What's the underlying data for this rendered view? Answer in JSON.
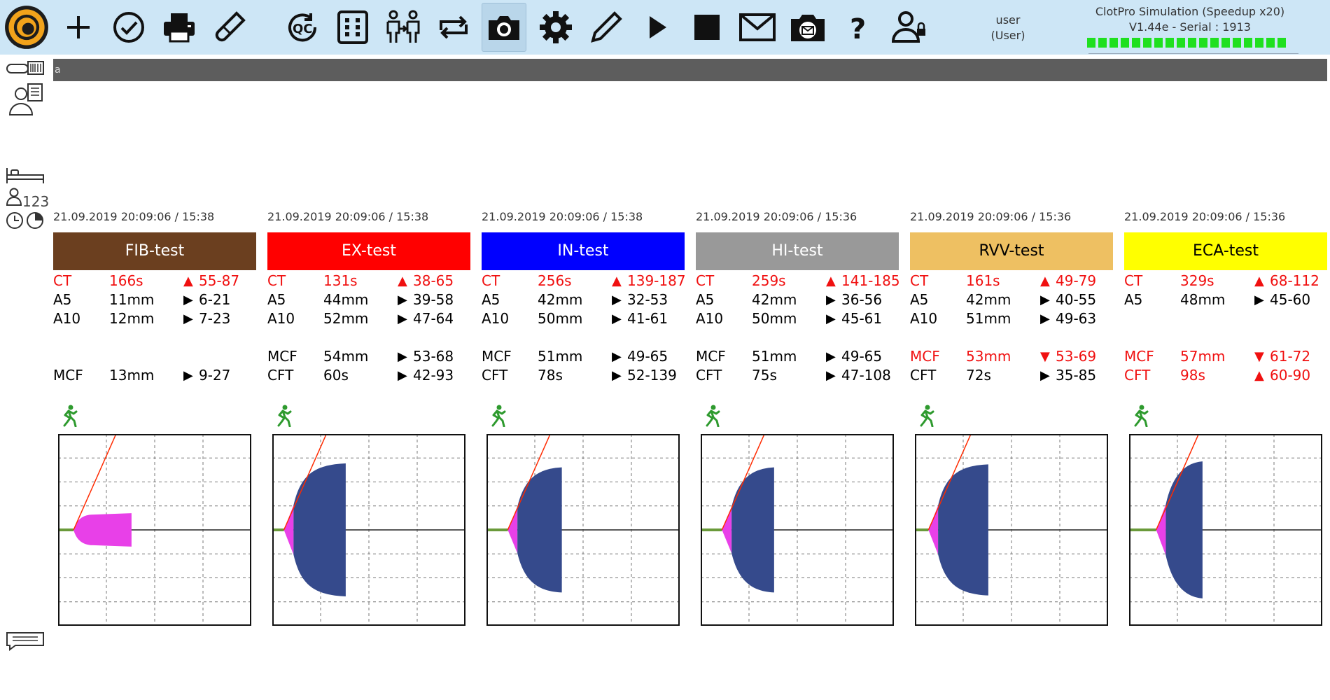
{
  "toolbar": {
    "buttons": [
      {
        "name": "logo-button",
        "icon": "clotpro-logo-icon"
      },
      {
        "name": "new-test-button",
        "icon": "plus-icon"
      },
      {
        "name": "confirm-button",
        "icon": "check-circle-icon"
      },
      {
        "name": "print-button",
        "icon": "printer-icon"
      },
      {
        "name": "pipette-button",
        "icon": "pipette-icon"
      },
      {
        "name": "qc-button",
        "icon": "qc-icon"
      },
      {
        "name": "keypad-button",
        "icon": "keypad-icon"
      },
      {
        "name": "transfer-patient-button",
        "icon": "patient-transfer-icon"
      },
      {
        "name": "swap-button",
        "icon": "swap-arrows-icon"
      },
      {
        "name": "camera-button",
        "icon": "camera-icon"
      },
      {
        "name": "settings-button",
        "icon": "gear-icon"
      },
      {
        "name": "edit-button",
        "icon": "pencil-icon"
      },
      {
        "name": "play-button",
        "icon": "play-icon"
      },
      {
        "name": "stop-button",
        "icon": "stop-icon"
      },
      {
        "name": "mail-button",
        "icon": "mail-icon"
      },
      {
        "name": "camera-mail-button",
        "icon": "camera-mail-icon"
      },
      {
        "name": "help-button",
        "icon": "question-icon"
      },
      {
        "name": "user-lock-button",
        "icon": "user-lock-icon"
      }
    ],
    "user_name": "user",
    "user_role": "(User)",
    "sim_title": "ClotPro Simulation (Speedup x20)",
    "version": "V1.44e - Serial : 1913",
    "status_leds": 18,
    "colors": {
      "background": "#cde6f6",
      "led": "#1fe01f"
    }
  },
  "sidebar": {
    "patient_count_label": "123"
  },
  "id_bar": {
    "text": "a"
  },
  "tests": [
    {
      "timestamp": "21.09.2019 20:09:06 / 15:38",
      "name": "FIB-test",
      "color": "#6b3f1f",
      "text_color": "#ffffff",
      "params": [
        {
          "name": "CT",
          "value": "166s",
          "arrow": "▲",
          "range": "55-87",
          "warn": true
        },
        {
          "name": "A5",
          "value": "11mm",
          "arrow": "▶",
          "range": "6-21",
          "warn": false
        },
        {
          "name": "A10",
          "value": "12mm",
          "arrow": "▶",
          "range": "7-23",
          "warn": false
        },
        {
          "name": "",
          "value": "",
          "arrow": "",
          "range": "",
          "warn": false
        },
        {
          "name": "",
          "value": "",
          "arrow": "",
          "range": "",
          "warn": false
        },
        {
          "name": "MCF",
          "value": "13mm",
          "arrow": "▶",
          "range": "9-27",
          "warn": false
        }
      ],
      "curve": {
        "ct_fraction": 0.08,
        "mcf_fraction": 0.16,
        "end_fraction": 0.38,
        "fill": "#e840e8",
        "slope": "#ff2a00"
      }
    },
    {
      "timestamp": "21.09.2019 20:09:06 / 15:38",
      "name": "EX-test",
      "color": "#ff0000",
      "text_color": "#ffffff",
      "params": [
        {
          "name": "CT",
          "value": "131s",
          "arrow": "▲",
          "range": "38-65",
          "warn": true
        },
        {
          "name": "A5",
          "value": "44mm",
          "arrow": "▶",
          "range": "39-58",
          "warn": false
        },
        {
          "name": "A10",
          "value": "52mm",
          "arrow": "▶",
          "range": "47-64",
          "warn": false
        },
        {
          "name": "",
          "value": "",
          "arrow": "",
          "range": "",
          "warn": false
        },
        {
          "name": "MCF",
          "value": "54mm",
          "arrow": "▶",
          "range": "53-68",
          "warn": false
        },
        {
          "name": "CFT",
          "value": "60s",
          "arrow": "▶",
          "range": "42-93",
          "warn": false
        }
      ],
      "curve": {
        "ct_fraction": 0.06,
        "mcf_fraction": 0.68,
        "end_fraction": 0.38,
        "fill": "#354a8c",
        "slope": "#ff2a00"
      }
    },
    {
      "timestamp": "21.09.2019 20:09:06 / 15:38",
      "name": "IN-test",
      "color": "#0000ff",
      "text_color": "#ffffff",
      "params": [
        {
          "name": "CT",
          "value": "256s",
          "arrow": "▲",
          "range": "139-187",
          "warn": true
        },
        {
          "name": "A5",
          "value": "42mm",
          "arrow": "▶",
          "range": "32-53",
          "warn": false
        },
        {
          "name": "A10",
          "value": "50mm",
          "arrow": "▶",
          "range": "41-61",
          "warn": false
        },
        {
          "name": "",
          "value": "",
          "arrow": "",
          "range": "",
          "warn": false
        },
        {
          "name": "MCF",
          "value": "51mm",
          "arrow": "▶",
          "range": "49-65",
          "warn": false
        },
        {
          "name": "CFT",
          "value": "78s",
          "arrow": "▶",
          "range": "52-139",
          "warn": false
        }
      ],
      "curve": {
        "ct_fraction": 0.11,
        "mcf_fraction": 0.64,
        "end_fraction": 0.39,
        "fill": "#354a8c",
        "slope": "#ff2a00"
      }
    },
    {
      "timestamp": "21.09.2019 20:09:06 / 15:36",
      "name": "HI-test",
      "color": "#999999",
      "text_color": "#ffffff",
      "params": [
        {
          "name": "CT",
          "value": "259s",
          "arrow": "▲",
          "range": "141-185",
          "warn": true
        },
        {
          "name": "A5",
          "value": "42mm",
          "arrow": "▶",
          "range": "36-56",
          "warn": false
        },
        {
          "name": "A10",
          "value": "50mm",
          "arrow": "▶",
          "range": "45-61",
          "warn": false
        },
        {
          "name": "",
          "value": "",
          "arrow": "",
          "range": "",
          "warn": false
        },
        {
          "name": "MCF",
          "value": "51mm",
          "arrow": "▶",
          "range": "49-65",
          "warn": false
        },
        {
          "name": "CFT",
          "value": "75s",
          "arrow": "▶",
          "range": "47-108",
          "warn": false
        }
      ],
      "curve": {
        "ct_fraction": 0.11,
        "mcf_fraction": 0.64,
        "end_fraction": 0.38,
        "fill": "#354a8c",
        "slope": "#ff2a00"
      }
    },
    {
      "timestamp": "21.09.2019 20:09:06 / 15:36",
      "name": "RVV-test",
      "color": "#eec062",
      "text_color": "#000000",
      "params": [
        {
          "name": "CT",
          "value": "161s",
          "arrow": "▲",
          "range": "49-79",
          "warn": true
        },
        {
          "name": "A5",
          "value": "42mm",
          "arrow": "▶",
          "range": "40-55",
          "warn": false
        },
        {
          "name": "A10",
          "value": "51mm",
          "arrow": "▶",
          "range": "49-63",
          "warn": false
        },
        {
          "name": "",
          "value": "",
          "arrow": "",
          "range": "",
          "warn": false
        },
        {
          "name": "MCF",
          "value": "53mm",
          "arrow": "▼",
          "range": "53-69",
          "warn": true
        },
        {
          "name": "CFT",
          "value": "72s",
          "arrow": "▶",
          "range": "35-85",
          "warn": false
        }
      ],
      "curve": {
        "ct_fraction": 0.07,
        "mcf_fraction": 0.67,
        "end_fraction": 0.38,
        "fill": "#354a8c",
        "slope": "#ff2a00"
      }
    },
    {
      "timestamp": "21.09.2019 20:09:06 / 15:36",
      "name": "ECA-test",
      "color": "#ffff00",
      "text_color": "#000000",
      "params": [
        {
          "name": "CT",
          "value": "329s",
          "arrow": "▲",
          "range": "68-112",
          "warn": true
        },
        {
          "name": "A5",
          "value": "48mm",
          "arrow": "▶",
          "range": "45-60",
          "warn": false
        },
        {
          "name": "",
          "value": "",
          "arrow": "",
          "range": "",
          "warn": false
        },
        {
          "name": "",
          "value": "",
          "arrow": "",
          "range": "",
          "warn": false
        },
        {
          "name": "MCF",
          "value": "57mm",
          "arrow": "▼",
          "range": "61-72",
          "warn": true
        },
        {
          "name": "CFT",
          "value": "98s",
          "arrow": "▲",
          "range": "60-90",
          "warn": true
        }
      ],
      "curve": {
        "ct_fraction": 0.14,
        "mcf_fraction": 0.7,
        "end_fraction": 0.38,
        "fill": "#354a8c",
        "slope": "#ff2a00"
      }
    }
  ]
}
